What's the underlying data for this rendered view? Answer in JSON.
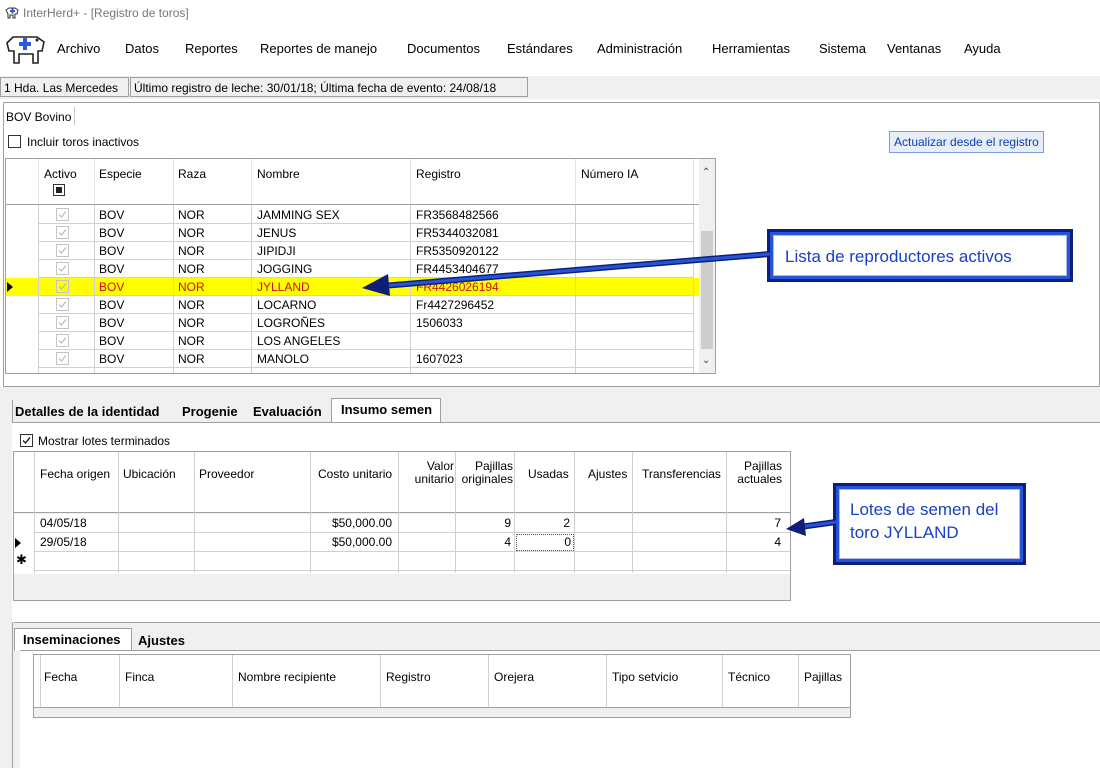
{
  "window": {
    "title": "InterHerd+ - [Registro de toros]"
  },
  "menu": [
    "Archivo",
    "Datos",
    "Reportes",
    "Reportes de manejo",
    "Documentos",
    "Estándares",
    "Administración",
    "Herramientas",
    "Sistema",
    "Ventanas",
    "Ayuda"
  ],
  "status": {
    "farm": "1 Hda. Las Mercedes",
    "info": "Último registro de leche: 30/01/18; Última fecha de evento: 24/08/18"
  },
  "species_tab": "BOV Bovino",
  "include_inactive": {
    "label": "Incluir toros inactivos",
    "checked": false
  },
  "update_button": "Actualizar desde el registro",
  "bulls_grid": {
    "columns": [
      "Activo",
      "Especie",
      "Raza",
      "Nombre",
      "Registro",
      "Número IA"
    ],
    "rows": [
      {
        "especie": "BOV",
        "raza": "NOR",
        "nombre": "JAMMING SEX",
        "registro": "FR3568482566",
        "ia": ""
      },
      {
        "especie": "BOV",
        "raza": "NOR",
        "nombre": "JENUS",
        "registro": "FR5344032081",
        "ia": ""
      },
      {
        "especie": "BOV",
        "raza": "NOR",
        "nombre": "JIPIDJI",
        "registro": "FR5350920122",
        "ia": ""
      },
      {
        "especie": "BOV",
        "raza": "NOR",
        "nombre": "JOGGING",
        "registro": "FR4453404677",
        "ia": ""
      },
      {
        "especie": "BOV",
        "raza": "NOR",
        "nombre": "JYLLAND",
        "registro": "FR4426026194",
        "ia": ""
      },
      {
        "especie": "BOV",
        "raza": "NOR",
        "nombre": "LOCARNO",
        "registro": "Fr4427296452",
        "ia": ""
      },
      {
        "especie": "BOV",
        "raza": "NOR",
        "nombre": "LOGROÑES",
        "registro": "1506033",
        "ia": ""
      },
      {
        "especie": "BOV",
        "raza": "NOR",
        "nombre": "LOS ANGELES",
        "registro": "",
        "ia": ""
      },
      {
        "especie": "BOV",
        "raza": "NOR",
        "nombre": "MANOLO",
        "registro": "1607023",
        "ia": ""
      }
    ]
  },
  "callout_bulls": "Lista de reproductores activos",
  "detail_tabs": [
    "Detalles de la identidad",
    "Progenie",
    "Evaluación",
    "Insumo semen"
  ],
  "show_finished": {
    "label": "Mostrar lotes terminados",
    "checked": true
  },
  "lots_grid": {
    "columns": [
      "Fecha origen",
      "Ubicación",
      "Proveedor",
      "Costo unitario",
      "Valor unitario",
      "Pajillas originales",
      "Usadas",
      "Ajustes",
      "Transferencias",
      "Pajillas actuales"
    ],
    "rows": [
      {
        "fecha": "04/05/18",
        "ubicacion": "",
        "proveedor": "",
        "costo": "$50,000.00",
        "valor": "",
        "originales": "9",
        "usadas": "2",
        "ajustes": "",
        "transferencias": "",
        "actuales": "7"
      },
      {
        "fecha": "29/05/18",
        "ubicacion": "",
        "proveedor": "",
        "costo": "$50,000.00",
        "valor": "",
        "originales": "4",
        "usadas": "0",
        "ajustes": "",
        "transferencias": "",
        "actuales": "4"
      }
    ]
  },
  "callout_lots": "Lotes de semen del toro JYLLAND",
  "bottom_tabs": [
    "Inseminaciones",
    "Ajustes"
  ],
  "insem_grid": {
    "columns": [
      "Fecha",
      "Finca",
      "Nombre recipiente",
      "Registro",
      "Orejera",
      "Tipo setvicio",
      "Técnico",
      "Pajillas"
    ]
  },
  "colors": {
    "selected_row": "#ffff00",
    "selected_text": "#d11000",
    "callout_blue": "#2455d9"
  }
}
